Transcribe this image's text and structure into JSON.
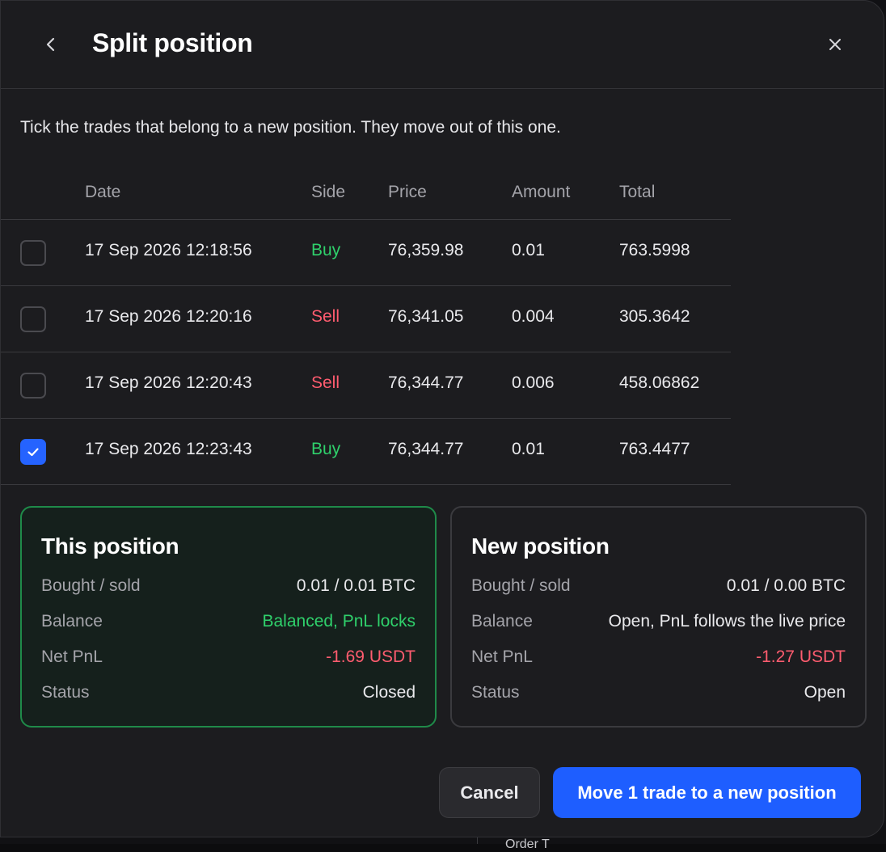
{
  "dialog": {
    "title": "Split position",
    "instruction": "Tick the trades that belong to a new position. They move out of this one."
  },
  "table": {
    "headers": {
      "date": "Date",
      "side": "Side",
      "price": "Price",
      "amount": "Amount",
      "total": "Total"
    },
    "rows": [
      {
        "checked": false,
        "date": "17 Sep 2026 12:18:56",
        "side": "Buy",
        "price": "76,359.98",
        "amount": "0.01",
        "total": "763.5998"
      },
      {
        "checked": false,
        "date": "17 Sep 2026 12:20:16",
        "side": "Sell",
        "price": "76,341.05",
        "amount": "0.004",
        "total": "305.3642"
      },
      {
        "checked": false,
        "date": "17 Sep 2026 12:20:43",
        "side": "Sell",
        "price": "76,344.77",
        "amount": "0.006",
        "total": "458.06862"
      },
      {
        "checked": true,
        "date": "17 Sep 2026 12:23:43",
        "side": "Buy",
        "price": "76,344.77",
        "amount": "0.01",
        "total": "763.4477"
      }
    ]
  },
  "this_position": {
    "title": "This position",
    "bought_sold_label": "Bought / sold",
    "bought_sold_value": "0.01 / 0.01 BTC",
    "balance_label": "Balance",
    "balance_value": "Balanced, PnL locks",
    "net_pnl_label": "Net PnL",
    "net_pnl_value": "-1.69 USDT",
    "status_label": "Status",
    "status_value": "Closed"
  },
  "new_position": {
    "title": "New position",
    "bought_sold_label": "Bought / sold",
    "bought_sold_value": "0.01 / 0.00 BTC",
    "balance_label": "Balance",
    "balance_value": "Open, PnL follows the live price",
    "net_pnl_label": "Net PnL",
    "net_pnl_value": "-1.27 USDT",
    "status_label": "Status",
    "status_value": "Open"
  },
  "actions": {
    "cancel_label": "Cancel",
    "confirm_label": "Move 1 trade to a new position"
  },
  "backdrop": {
    "partial_text": "Order T"
  },
  "colors": {
    "buy": "#2fd06b",
    "sell": "#ff5c6f",
    "accent": "#1e5eff",
    "this_position_border": "#1f8a49"
  },
  "icons": {
    "back": "chevron-left-icon",
    "close": "close-icon",
    "check": "check-icon"
  }
}
